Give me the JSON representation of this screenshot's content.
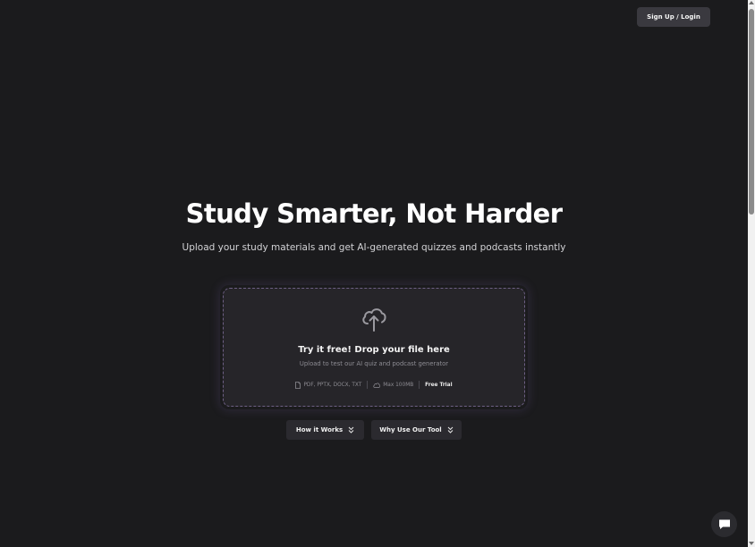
{
  "header": {
    "login_label": "Sign Up / Login"
  },
  "hero": {
    "title": "Study Smarter, Not Harder",
    "subtitle": "Upload your study materials and get AI-generated quizzes and podcasts instantly"
  },
  "upload": {
    "icon": "cloud-upload-icon",
    "title": "Try it free! Drop your file here",
    "subtitle": "Upload to test our AI quiz and podcast generator",
    "formats": "PDF, PPTX, DOCX, TXT",
    "max_size": "Max 100MB",
    "badge": "Free Trial"
  },
  "actions": {
    "how_label": "How it Works",
    "why_label": "Why Use Our Tool"
  },
  "chat": {
    "icon": "chat-bubble-icon"
  },
  "colors": {
    "background": "#1b1b1d",
    "button": "#3a393f",
    "dropzone": "#262529",
    "dropzone_border": "#6d5f84",
    "pill": "#2b2a2f"
  }
}
